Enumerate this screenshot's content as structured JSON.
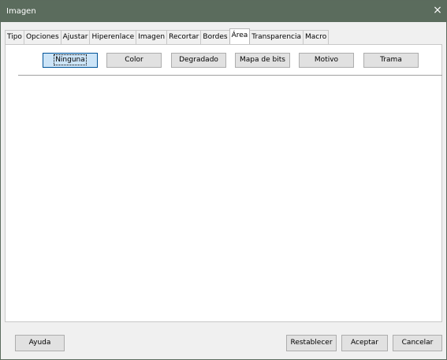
{
  "window": {
    "title": "Imagen"
  },
  "tabs": [
    "Tipo",
    "Opciones",
    "Ajustar",
    "Hiperenlace",
    "Imagen",
    "Recortar",
    "Bordes",
    "Área",
    "Transparencia",
    "Macro"
  ],
  "area": {
    "buttons": [
      "Ninguna",
      "Color",
      "Degradado",
      "Mapa de bits",
      "Motivo",
      "Trama"
    ],
    "selected": "Ninguna"
  },
  "footer": {
    "help": "Ayuda",
    "reset": "Restablecer",
    "ok": "Aceptar",
    "cancel": "Cancelar"
  },
  "icons": {
    "close": "close-icon"
  }
}
